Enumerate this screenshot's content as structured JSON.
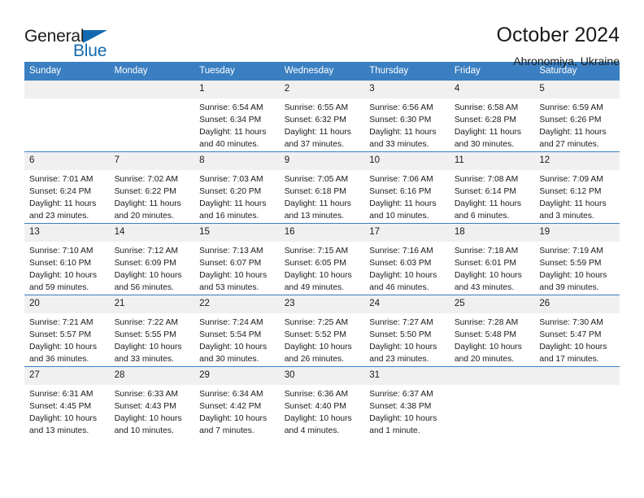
{
  "brand": {
    "name_part1": "General",
    "name_part2": "Blue",
    "primary_color": "#1269b0",
    "header_color": "#3a7fc1"
  },
  "header": {
    "title": "October 2024",
    "subtitle": "Ahronomiya, Ukraine"
  },
  "weekday_headers": [
    "Sunday",
    "Monday",
    "Tuesday",
    "Wednesday",
    "Thursday",
    "Friday",
    "Saturday"
  ],
  "weeks": [
    [
      {
        "day": "",
        "sunrise": "",
        "sunset": "",
        "daylight": "",
        "daylight2": ""
      },
      {
        "day": "",
        "sunrise": "",
        "sunset": "",
        "daylight": "",
        "daylight2": ""
      },
      {
        "day": "1",
        "sunrise": "Sunrise: 6:54 AM",
        "sunset": "Sunset: 6:34 PM",
        "daylight": "Daylight: 11 hours",
        "daylight2": "and 40 minutes."
      },
      {
        "day": "2",
        "sunrise": "Sunrise: 6:55 AM",
        "sunset": "Sunset: 6:32 PM",
        "daylight": "Daylight: 11 hours",
        "daylight2": "and 37 minutes."
      },
      {
        "day": "3",
        "sunrise": "Sunrise: 6:56 AM",
        "sunset": "Sunset: 6:30 PM",
        "daylight": "Daylight: 11 hours",
        "daylight2": "and 33 minutes."
      },
      {
        "day": "4",
        "sunrise": "Sunrise: 6:58 AM",
        "sunset": "Sunset: 6:28 PM",
        "daylight": "Daylight: 11 hours",
        "daylight2": "and 30 minutes."
      },
      {
        "day": "5",
        "sunrise": "Sunrise: 6:59 AM",
        "sunset": "Sunset: 6:26 PM",
        "daylight": "Daylight: 11 hours",
        "daylight2": "and 27 minutes."
      }
    ],
    [
      {
        "day": "6",
        "sunrise": "Sunrise: 7:01 AM",
        "sunset": "Sunset: 6:24 PM",
        "daylight": "Daylight: 11 hours",
        "daylight2": "and 23 minutes."
      },
      {
        "day": "7",
        "sunrise": "Sunrise: 7:02 AM",
        "sunset": "Sunset: 6:22 PM",
        "daylight": "Daylight: 11 hours",
        "daylight2": "and 20 minutes."
      },
      {
        "day": "8",
        "sunrise": "Sunrise: 7:03 AM",
        "sunset": "Sunset: 6:20 PM",
        "daylight": "Daylight: 11 hours",
        "daylight2": "and 16 minutes."
      },
      {
        "day": "9",
        "sunrise": "Sunrise: 7:05 AM",
        "sunset": "Sunset: 6:18 PM",
        "daylight": "Daylight: 11 hours",
        "daylight2": "and 13 minutes."
      },
      {
        "day": "10",
        "sunrise": "Sunrise: 7:06 AM",
        "sunset": "Sunset: 6:16 PM",
        "daylight": "Daylight: 11 hours",
        "daylight2": "and 10 minutes."
      },
      {
        "day": "11",
        "sunrise": "Sunrise: 7:08 AM",
        "sunset": "Sunset: 6:14 PM",
        "daylight": "Daylight: 11 hours",
        "daylight2": "and 6 minutes."
      },
      {
        "day": "12",
        "sunrise": "Sunrise: 7:09 AM",
        "sunset": "Sunset: 6:12 PM",
        "daylight": "Daylight: 11 hours",
        "daylight2": "and 3 minutes."
      }
    ],
    [
      {
        "day": "13",
        "sunrise": "Sunrise: 7:10 AM",
        "sunset": "Sunset: 6:10 PM",
        "daylight": "Daylight: 10 hours",
        "daylight2": "and 59 minutes."
      },
      {
        "day": "14",
        "sunrise": "Sunrise: 7:12 AM",
        "sunset": "Sunset: 6:09 PM",
        "daylight": "Daylight: 10 hours",
        "daylight2": "and 56 minutes."
      },
      {
        "day": "15",
        "sunrise": "Sunrise: 7:13 AM",
        "sunset": "Sunset: 6:07 PM",
        "daylight": "Daylight: 10 hours",
        "daylight2": "and 53 minutes."
      },
      {
        "day": "16",
        "sunrise": "Sunrise: 7:15 AM",
        "sunset": "Sunset: 6:05 PM",
        "daylight": "Daylight: 10 hours",
        "daylight2": "and 49 minutes."
      },
      {
        "day": "17",
        "sunrise": "Sunrise: 7:16 AM",
        "sunset": "Sunset: 6:03 PM",
        "daylight": "Daylight: 10 hours",
        "daylight2": "and 46 minutes."
      },
      {
        "day": "18",
        "sunrise": "Sunrise: 7:18 AM",
        "sunset": "Sunset: 6:01 PM",
        "daylight": "Daylight: 10 hours",
        "daylight2": "and 43 minutes."
      },
      {
        "day": "19",
        "sunrise": "Sunrise: 7:19 AM",
        "sunset": "Sunset: 5:59 PM",
        "daylight": "Daylight: 10 hours",
        "daylight2": "and 39 minutes."
      }
    ],
    [
      {
        "day": "20",
        "sunrise": "Sunrise: 7:21 AM",
        "sunset": "Sunset: 5:57 PM",
        "daylight": "Daylight: 10 hours",
        "daylight2": "and 36 minutes."
      },
      {
        "day": "21",
        "sunrise": "Sunrise: 7:22 AM",
        "sunset": "Sunset: 5:55 PM",
        "daylight": "Daylight: 10 hours",
        "daylight2": "and 33 minutes."
      },
      {
        "day": "22",
        "sunrise": "Sunrise: 7:24 AM",
        "sunset": "Sunset: 5:54 PM",
        "daylight": "Daylight: 10 hours",
        "daylight2": "and 30 minutes."
      },
      {
        "day": "23",
        "sunrise": "Sunrise: 7:25 AM",
        "sunset": "Sunset: 5:52 PM",
        "daylight": "Daylight: 10 hours",
        "daylight2": "and 26 minutes."
      },
      {
        "day": "24",
        "sunrise": "Sunrise: 7:27 AM",
        "sunset": "Sunset: 5:50 PM",
        "daylight": "Daylight: 10 hours",
        "daylight2": "and 23 minutes."
      },
      {
        "day": "25",
        "sunrise": "Sunrise: 7:28 AM",
        "sunset": "Sunset: 5:48 PM",
        "daylight": "Daylight: 10 hours",
        "daylight2": "and 20 minutes."
      },
      {
        "day": "26",
        "sunrise": "Sunrise: 7:30 AM",
        "sunset": "Sunset: 5:47 PM",
        "daylight": "Daylight: 10 hours",
        "daylight2": "and 17 minutes."
      }
    ],
    [
      {
        "day": "27",
        "sunrise": "Sunrise: 6:31 AM",
        "sunset": "Sunset: 4:45 PM",
        "daylight": "Daylight: 10 hours",
        "daylight2": "and 13 minutes."
      },
      {
        "day": "28",
        "sunrise": "Sunrise: 6:33 AM",
        "sunset": "Sunset: 4:43 PM",
        "daylight": "Daylight: 10 hours",
        "daylight2": "and 10 minutes."
      },
      {
        "day": "29",
        "sunrise": "Sunrise: 6:34 AM",
        "sunset": "Sunset: 4:42 PM",
        "daylight": "Daylight: 10 hours",
        "daylight2": "and 7 minutes."
      },
      {
        "day": "30",
        "sunrise": "Sunrise: 6:36 AM",
        "sunset": "Sunset: 4:40 PM",
        "daylight": "Daylight: 10 hours",
        "daylight2": "and 4 minutes."
      },
      {
        "day": "31",
        "sunrise": "Sunrise: 6:37 AM",
        "sunset": "Sunset: 4:38 PM",
        "daylight": "Daylight: 10 hours",
        "daylight2": "and 1 minute."
      },
      {
        "day": "",
        "sunrise": "",
        "sunset": "",
        "daylight": "",
        "daylight2": ""
      },
      {
        "day": "",
        "sunrise": "",
        "sunset": "",
        "daylight": "",
        "daylight2": ""
      }
    ]
  ]
}
